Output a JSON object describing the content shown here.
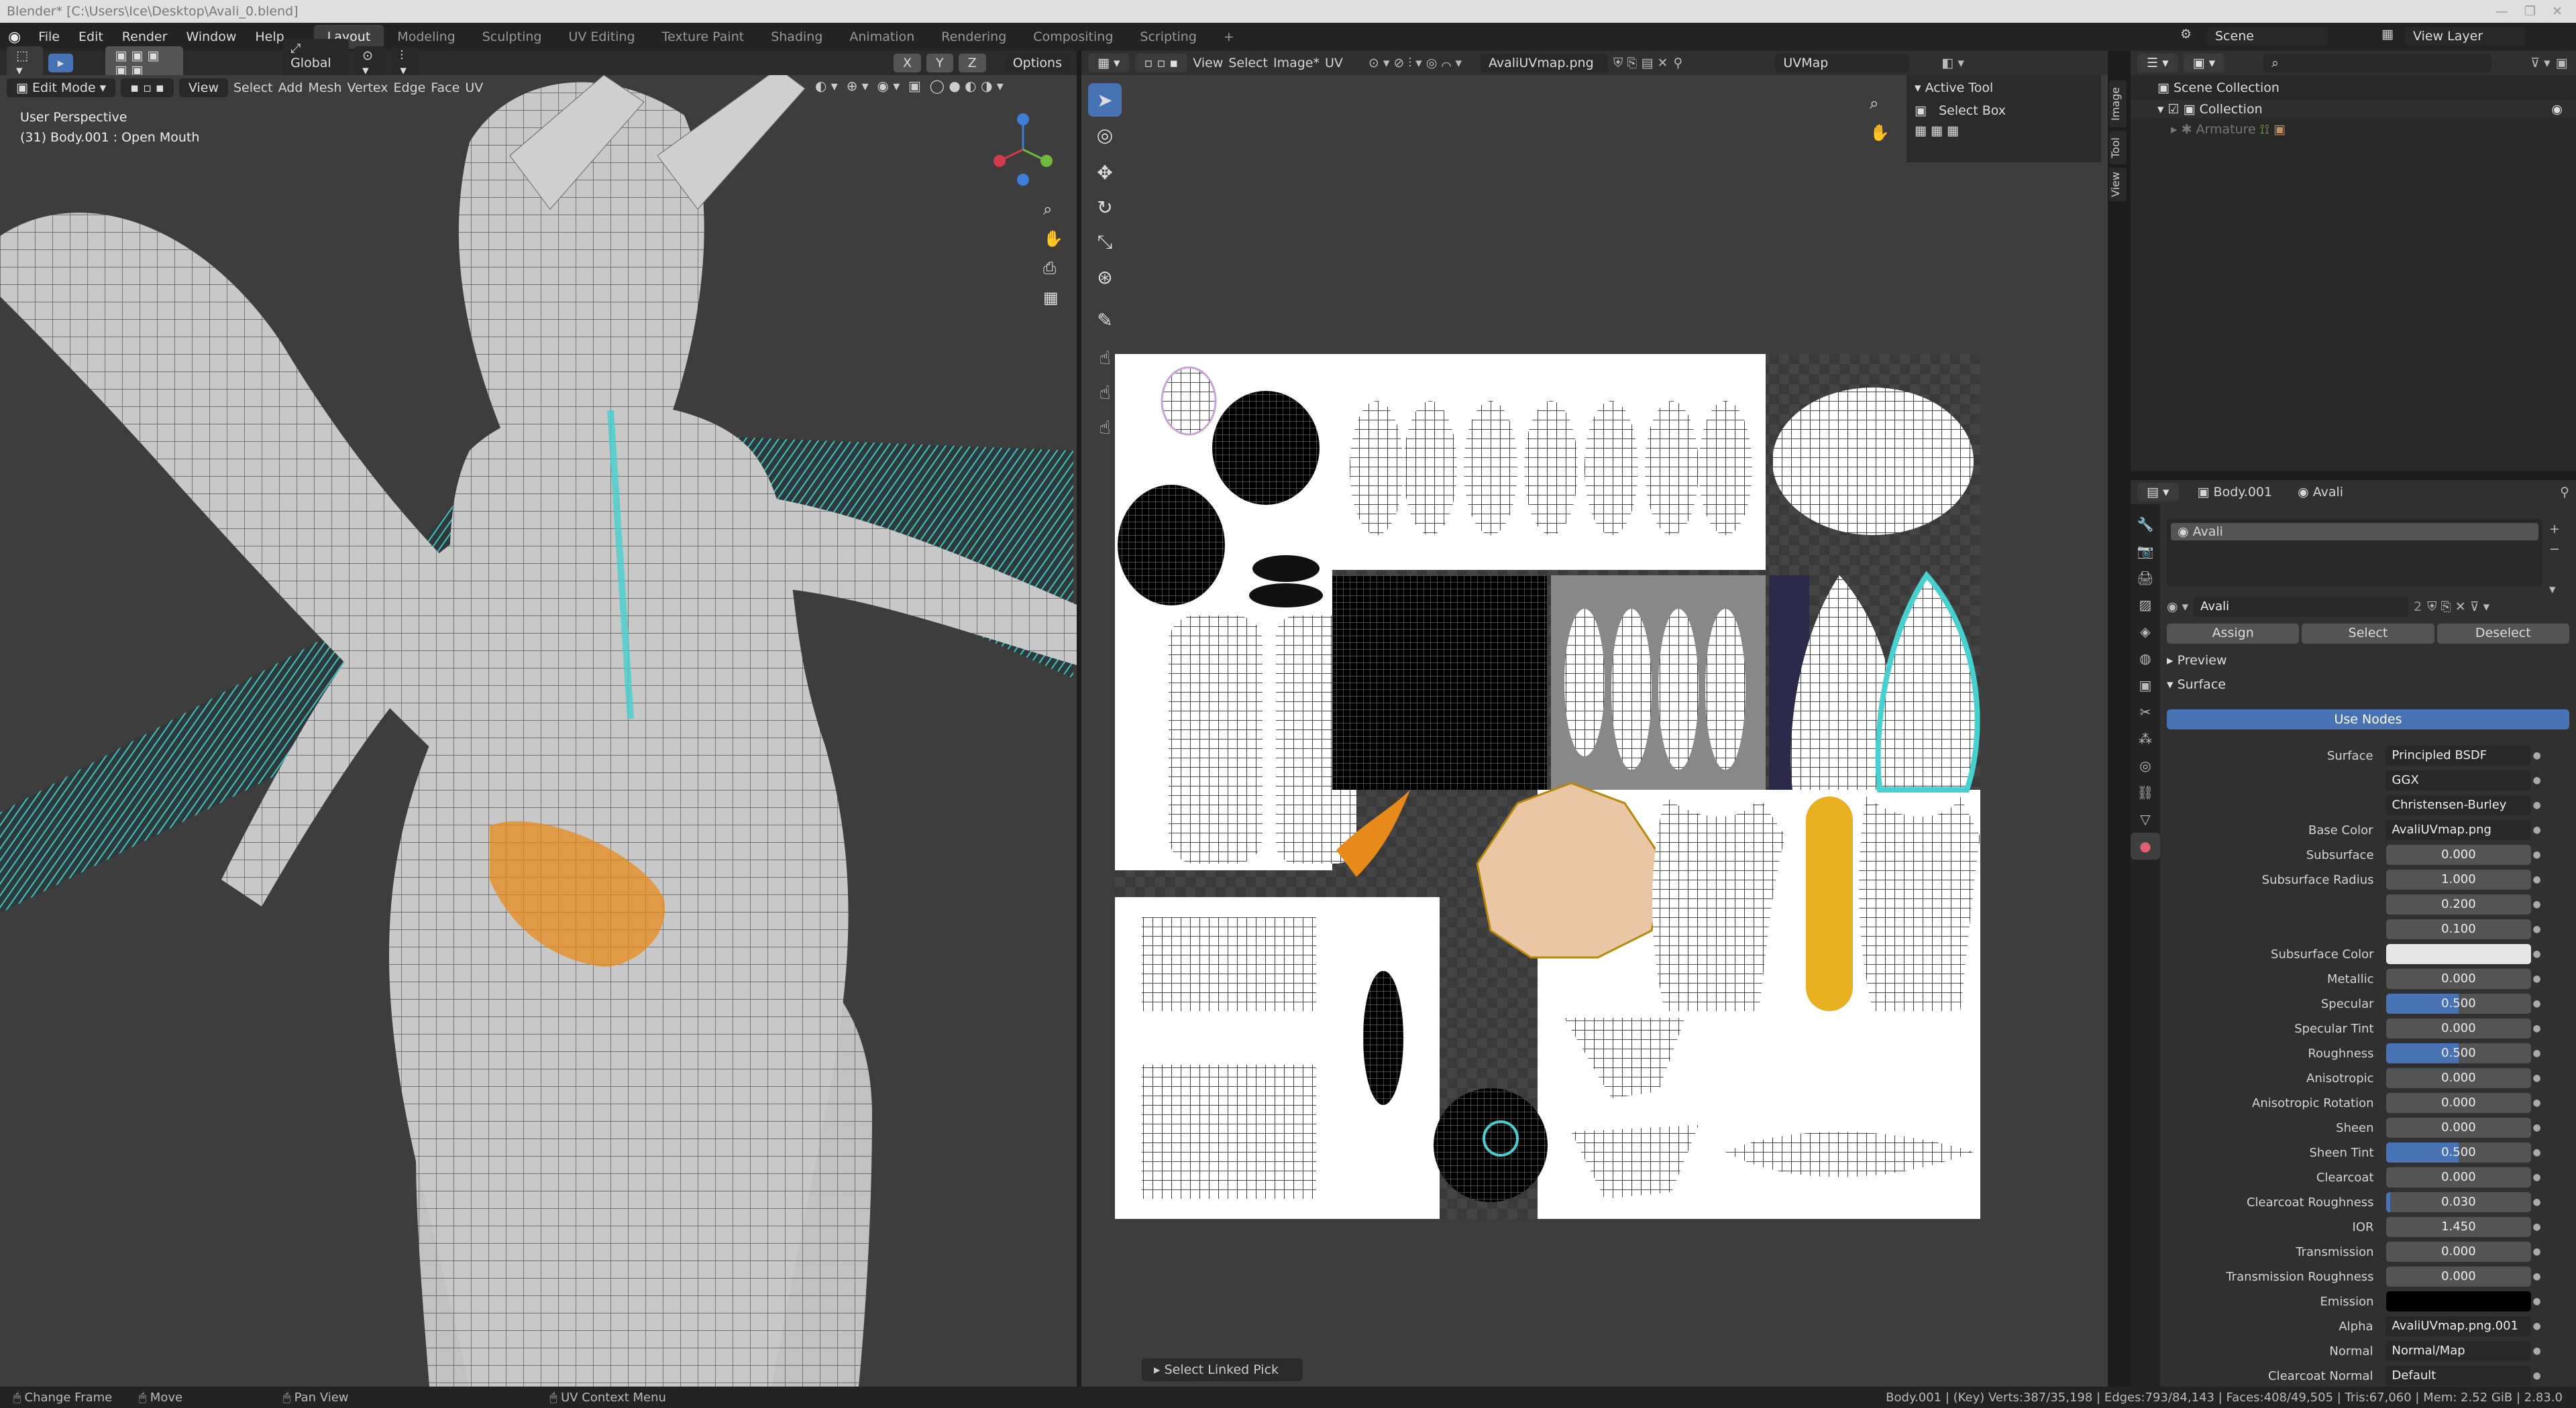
{
  "window_title": "Blender* [C:\\Users\\Ice\\Desktop\\Avali_0.blend]",
  "menu": [
    "File",
    "Edit",
    "Render",
    "Window",
    "Help"
  ],
  "workspaces": [
    "Layout",
    "Modeling",
    "Sculpting",
    "UV Editing",
    "Texture Paint",
    "Shading",
    "Animation",
    "Rendering",
    "Compositing",
    "Scripting"
  ],
  "active_workspace": "Layout",
  "scene": {
    "label": "Scene",
    "view_layer": "View Layer"
  },
  "viewport": {
    "transform": "Global",
    "axes": [
      "X",
      "Y",
      "Z"
    ],
    "options": "Options",
    "mode": "Edit Mode",
    "menus": [
      "View",
      "Select",
      "Add",
      "Mesh",
      "Vertex",
      "Edge",
      "Face",
      "UV"
    ],
    "overlay_title": "User Perspective",
    "overlay_object": "(31) Body.001 : Open Mouth"
  },
  "uv_editor": {
    "menus": [
      "View",
      "Select",
      "Image*",
      "UV"
    ],
    "image_name": "AvaliUVmap.png",
    "uvmap": "UVMap",
    "active_tool_title": "Active Tool",
    "active_tool": "Select Box",
    "side_tabs": [
      "Image",
      "Tool",
      "View"
    ],
    "popup": "Select Linked Pick"
  },
  "outliner": {
    "items": [
      "Scene Collection",
      "Collection",
      "Armature"
    ]
  },
  "properties": {
    "object": "Body.001",
    "material": "Avali",
    "slot": "Avali",
    "material_field": "Avali",
    "users": "2",
    "buttons": [
      "Assign",
      "Select",
      "Deselect"
    ],
    "preview": "Preview",
    "surface_section": "Surface",
    "use_nodes": "Use Nodes",
    "rows": [
      {
        "label": "Surface",
        "value": "Principled BSDF",
        "kind": "dark"
      },
      {
        "label": "",
        "value": "GGX",
        "kind": "dark"
      },
      {
        "label": "",
        "value": "Christensen-Burley",
        "kind": "dark"
      },
      {
        "label": "Base Color",
        "value": "AvaliUVmap.png",
        "kind": "dark"
      },
      {
        "label": "Subsurface",
        "value": "0.000",
        "kind": "num"
      },
      {
        "label": "Subsurface Radius",
        "value": "1.000",
        "kind": "num"
      },
      {
        "label": "",
        "value": "0.200",
        "kind": "num"
      },
      {
        "label": "",
        "value": "0.100",
        "kind": "num"
      },
      {
        "label": "Subsurface Color",
        "value": "",
        "kind": "color"
      },
      {
        "label": "Metallic",
        "value": "0.000",
        "kind": "num"
      },
      {
        "label": "Specular",
        "value": "0.500",
        "kind": "slider",
        "fill": 0.5
      },
      {
        "label": "Specular Tint",
        "value": "0.000",
        "kind": "num"
      },
      {
        "label": "Roughness",
        "value": "0.500",
        "kind": "slider",
        "fill": 0.5
      },
      {
        "label": "Anisotropic",
        "value": "0.000",
        "kind": "num"
      },
      {
        "label": "Anisotropic Rotation",
        "value": "0.000",
        "kind": "num"
      },
      {
        "label": "Sheen",
        "value": "0.000",
        "kind": "num"
      },
      {
        "label": "Sheen Tint",
        "value": "0.500",
        "kind": "slider",
        "fill": 0.5
      },
      {
        "label": "Clearcoat",
        "value": "0.000",
        "kind": "num"
      },
      {
        "label": "Clearcoat Roughness",
        "value": "0.030",
        "kind": "slider",
        "fill": 0.03
      },
      {
        "label": "IOR",
        "value": "1.450",
        "kind": "num"
      },
      {
        "label": "Transmission",
        "value": "0.000",
        "kind": "num"
      },
      {
        "label": "Transmission Roughness",
        "value": "0.000",
        "kind": "num"
      },
      {
        "label": "Emission",
        "value": "",
        "kind": "black"
      },
      {
        "label": "Alpha",
        "value": "AvaliUVmap.png.001",
        "kind": "dark"
      },
      {
        "label": "Normal",
        "value": "Normal/Map",
        "kind": "dark"
      },
      {
        "label": "Clearcoat Normal",
        "value": "Default",
        "kind": "dark"
      }
    ]
  },
  "status": {
    "items": [
      "Change Frame",
      "Move",
      "Pan View",
      "UV Context Menu"
    ],
    "stats": "Body.001 | (Key) Verts:387/35,198 | Edges:793/84,143 | Faces:408/49,505 | Tris:67,060 | Mem: 2.52 GiB | 2.83.0"
  },
  "colors": {
    "accent": "#4772b3",
    "active_orange": "#e88a1a",
    "uv_teal": "#47d0d0"
  }
}
